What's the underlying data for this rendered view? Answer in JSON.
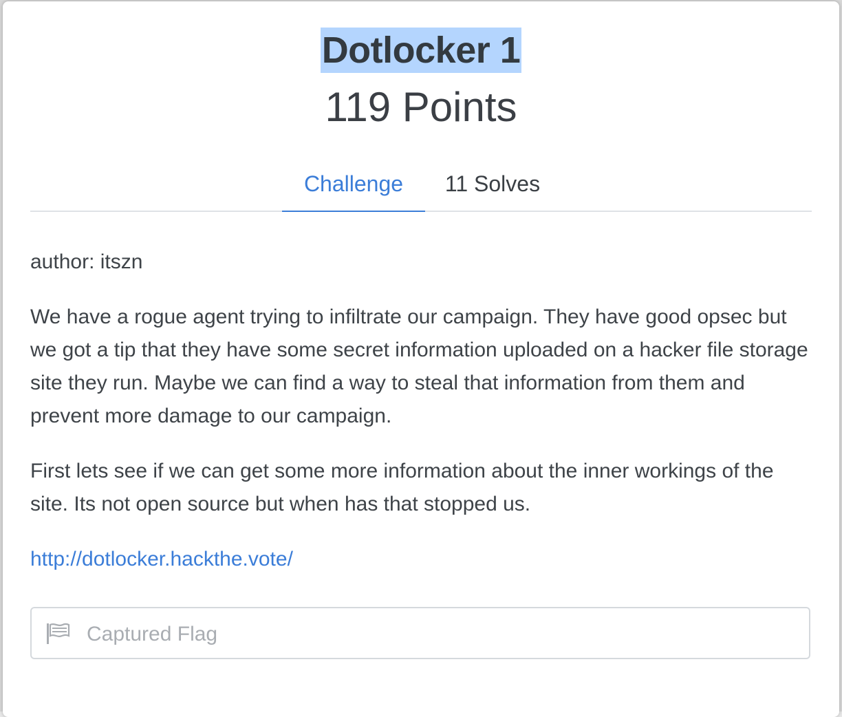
{
  "challenge": {
    "title": "Dotlocker 1",
    "points_label": "119 Points"
  },
  "tabs": [
    {
      "label": "Challenge",
      "active": true
    },
    {
      "label": "11 Solves",
      "active": false
    }
  ],
  "content": {
    "author": "author: itszn",
    "paragraph_1": "We have a rogue agent trying to infiltrate our campaign. They have good opsec but we got a tip that they have some secret information uploaded on a hacker file storage site they run. Maybe we can find a way to steal that information from them and prevent more damage to our campaign.",
    "paragraph_2": "First lets see if we can get some more information about the inner workings of the site. Its not open source but when has that stopped us.",
    "link_text": "http://dotlocker.hackthe.vote/"
  },
  "flag_input": {
    "placeholder": "Captured Flag",
    "value": "",
    "icon": "flag-icon"
  },
  "colors": {
    "accent": "#3b7dd8",
    "title_highlight": "#b4d5fe",
    "text": "#3e4348"
  }
}
